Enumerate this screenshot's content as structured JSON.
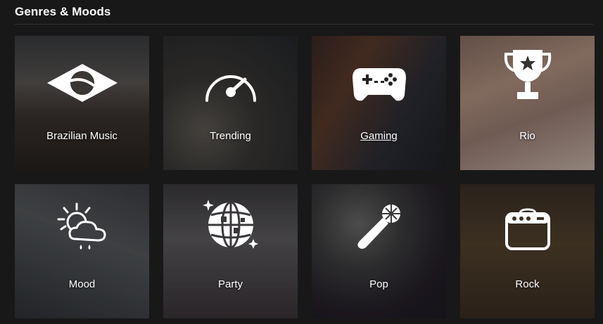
{
  "section": {
    "title": "Genres & Moods"
  },
  "tiles": [
    {
      "label": "Brazilian Music",
      "icon": "brazil-flag-icon"
    },
    {
      "label": "Trending",
      "icon": "speedometer-icon"
    },
    {
      "label": "Gaming",
      "icon": "game-controller-icon"
    },
    {
      "label": "Rio",
      "icon": "trophy-icon"
    },
    {
      "label": "Mood",
      "icon": "sun-cloud-icon"
    },
    {
      "label": "Party",
      "icon": "disco-ball-icon"
    },
    {
      "label": "Pop",
      "icon": "microphone-icon"
    },
    {
      "label": "Rock",
      "icon": "amplifier-icon"
    }
  ]
}
